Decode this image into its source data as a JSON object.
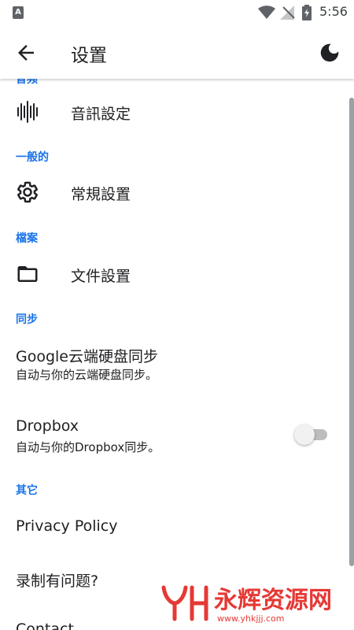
{
  "status_bar": {
    "time": "5:56",
    "notification_icon": "app-notification-icon",
    "wifi_icon": "wifi-icon",
    "signal_icon": "signal-icon",
    "battery_icon": "battery-charging-icon"
  },
  "app_bar": {
    "title": "设置",
    "back_icon": "arrow-back-icon",
    "theme_icon": "moon-icon"
  },
  "sections": {
    "cutoff_header": "音频",
    "audio": {
      "item_label": "音訊設定",
      "icon": "audio-waveform-icon"
    },
    "general": {
      "header": "一般的",
      "item_label": "常規設置",
      "icon": "gear-icon"
    },
    "files": {
      "header": "檔案",
      "item_label": "文件設置",
      "icon": "folder-icon"
    },
    "sync": {
      "header": "同步",
      "gdrive_title": "Google云端硬盘同步",
      "gdrive_summary": "自动与你的云端硬盘同步。",
      "dropbox_title": "Dropbox",
      "dropbox_summary": "自动与你的Dropbox同步。",
      "dropbox_enabled": false
    },
    "other": {
      "header": "其它",
      "privacy": "Privacy Policy",
      "recording_issue": "录制有问题?",
      "contact": "Contact"
    }
  },
  "watermark": {
    "text": "永辉资源网",
    "url": "www.yhkjjj.com"
  },
  "colors": {
    "accent": "#1a73e8",
    "text": "#202124",
    "watermark": "#e53935"
  }
}
